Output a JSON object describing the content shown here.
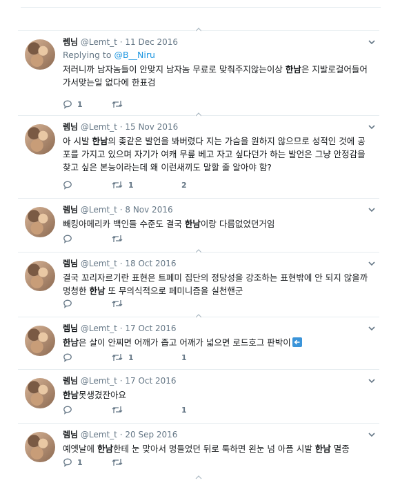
{
  "tweets": [
    {
      "name": "렘님",
      "handle": "@Lemt_t",
      "date": "11 Dec 2016",
      "replying_prefix": "Replying to ",
      "replying_to": "@B__Niru",
      "segments": [
        [
          "저러니까 남자놈들이 안맞지 남자놈 무료로 맞춰주지않는이상 ",
          false
        ],
        [
          "한남",
          true
        ],
        [
          "은 지발로걸어들어가서맞는일 없다에 한표검",
          false
        ]
      ],
      "reply_count": "1",
      "retweet_count": "",
      "like_count": ""
    },
    {
      "name": "렘님",
      "handle": "@Lemt_t",
      "date": "15 Nov 2016",
      "segments": [
        [
          "아 시발 ",
          false
        ],
        [
          "한남",
          true
        ],
        [
          "의 좆같은 발언을 봐버렸다 지는 가슴을 원하지 않으므로 성적인 것에 공포를 가지고 있으며 자기가 여캐 무릎 베고 자고 싶다던가 하는 발언은 그냥 안정감을 찾고 싶은 본능이라는데 왜 이런새끼도 말할 줄 알아야 함?",
          false
        ]
      ],
      "reply_count": "",
      "retweet_count": "1",
      "like_count": "2"
    },
    {
      "name": "렘님",
      "handle": "@Lemt_t",
      "date": "8 Nov 2016",
      "segments": [
        [
          "빼킹아메리카 백인들 수준도 결국 ",
          false
        ],
        [
          "한남",
          true
        ],
        [
          "이랑 다름없었던거임",
          false
        ]
      ],
      "reply_count": "",
      "retweet_count": "",
      "like_count": ""
    },
    {
      "name": "렘님",
      "handle": "@Lemt_t",
      "date": "18 Oct 2016",
      "segments": [
        [
          "결국 꼬리자르기란 표현은 트페미 집단의 정당성을 강조하는 표현밖에 안 되지 않을까 멍청한 ",
          false
        ],
        [
          "한남",
          true
        ],
        [
          " 또 무의식적으로 페미니즘을 실천핸군",
          false
        ]
      ],
      "reply_count": "",
      "retweet_count": "",
      "like_count": ""
    },
    {
      "name": "렘님",
      "handle": "@Lemt_t",
      "date": "17 Oct 2016",
      "segments": [
        [
          "한남",
          true
        ],
        [
          "은 살이 안찌면 어깨가 좁고 어깨가 넓으면 로드호그 판박이",
          false
        ]
      ],
      "trailing_icon": "left-arrow-emoji-icon",
      "reply_count": "",
      "retweet_count": "1",
      "like_count": "1"
    },
    {
      "name": "렘님",
      "handle": "@Lemt_t",
      "date": "17 Oct 2016",
      "segments": [
        [
          "한남",
          true
        ],
        [
          "못생겼잔아요",
          false
        ]
      ],
      "reply_count": "",
      "retweet_count": "",
      "like_count": "1"
    },
    {
      "name": "렘님",
      "handle": "@Lemt_t",
      "date": "20 Sep 2016",
      "segments": [
        [
          "예엣날에 ",
          false
        ],
        [
          "한남",
          true
        ],
        [
          "한테 눈 맞아서 멍들었던 뒤로 툭하면 왼눈 넘 아픔 시발 ",
          false
        ],
        [
          "한남",
          true
        ],
        [
          " 멸종",
          false
        ]
      ],
      "reply_count": "1",
      "retweet_count": "",
      "like_count": ""
    }
  ],
  "colors": {
    "accent": "#1b95e0",
    "muted": "#657786",
    "text": "#14171a",
    "border": "#e6ecf0"
  }
}
